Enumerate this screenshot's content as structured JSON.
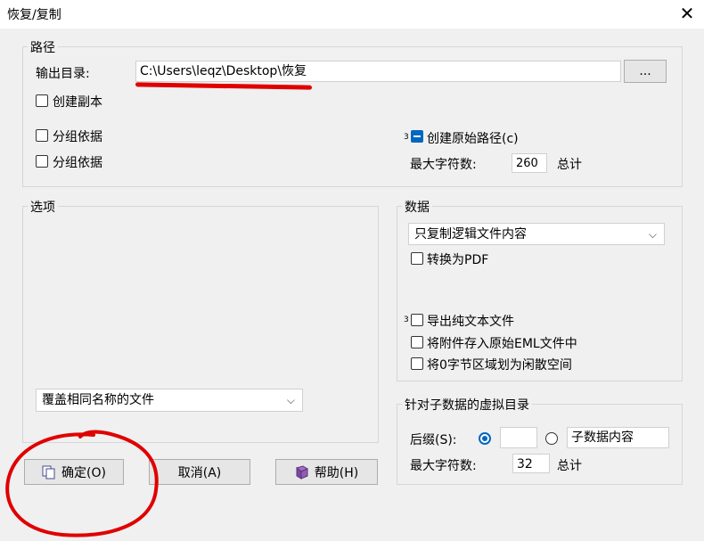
{
  "window": {
    "title": "恢复/复制",
    "close_glyph": "✕"
  },
  "path_group": {
    "legend": "路径",
    "output_label": "输出目录:",
    "output_value": "C:\\Users\\leqz\\Desktop\\恢复",
    "browse_label": "...",
    "create_copy_label": "创建副本",
    "group_by_1_label": "分组依据",
    "group_by_2_label": "分组依据",
    "marker_3": "3",
    "create_original_path_label": "创建原始路径(c)",
    "max_chars_label": "最大字符数:",
    "max_chars_value": "260",
    "total_label": "总计"
  },
  "options_group": {
    "legend": "选项",
    "overwrite_select": "覆盖相同名称的文件"
  },
  "data_group": {
    "legend": "数据",
    "copy_mode_select": "只复制逻辑文件内容",
    "convert_pdf_label": "转换为PDF",
    "marker_3": "3",
    "export_text_label": "导出纯文本文件",
    "attach_eml_label": "将附件存入原始EML文件中",
    "zero_byte_label": "将0字节区域划为闲散空间"
  },
  "virtual_group": {
    "legend": "针对子数据的虚拟目录",
    "suffix_label": "后缀(S):",
    "suffix_value": "",
    "child_content_value": "子数据内容",
    "max_chars_label": "最大字符数:",
    "max_chars_value": "32",
    "total_label": "总计"
  },
  "buttons": {
    "ok_label": "确定",
    "ok_key": "(O)",
    "cancel_label": "取消",
    "cancel_key": "(A)",
    "help_label": "帮助",
    "help_key": "(H)"
  }
}
